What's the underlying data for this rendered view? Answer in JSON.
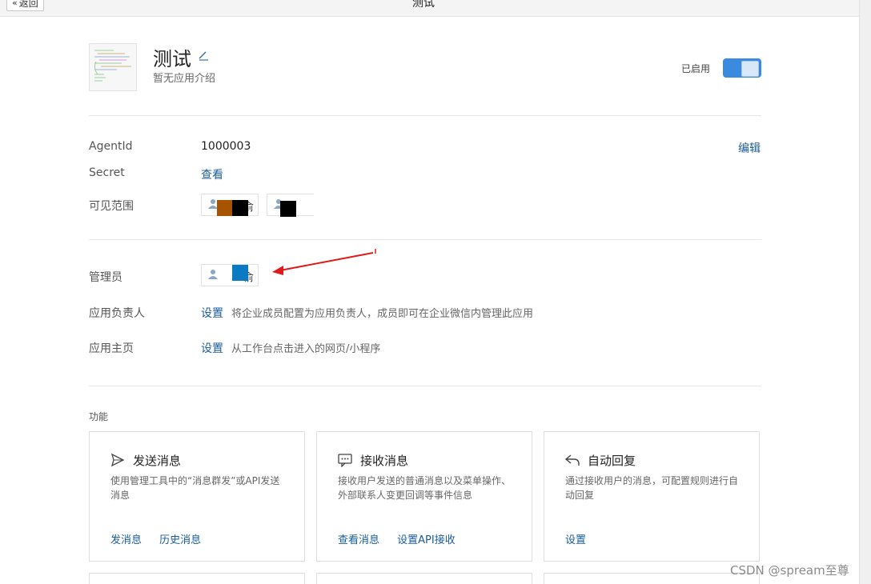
{
  "topbar": {
    "back_label": "返回",
    "title": "测试"
  },
  "app": {
    "name": "测试",
    "description": "暂无应用介绍",
    "status_label": "已启用",
    "enabled": true,
    "accent_color": "#3a8be0"
  },
  "details": {
    "agentid_label": "AgentId",
    "agentid_value": "1000003",
    "edit_label": "编辑",
    "secret_label": "Secret",
    "secret_action": "查看",
    "visibility_label": "可见范围",
    "visibility_chip_1_text": "俞",
    "visibility_chip_2_text": ""
  },
  "admin": {
    "admin_label": "管理员",
    "admin_chip_text": "俞",
    "owner_label": "应用负责人",
    "owner_action": "设置",
    "owner_hint": "将企业成员配置为应用负责人，成员即可在企业微信内管理此应用",
    "home_label": "应用主页",
    "home_action": "设置",
    "home_hint": "从工作台点击进入的网页/小程序"
  },
  "features": {
    "section_label": "功能",
    "cards": [
      {
        "icon": "send-icon",
        "title": "发送消息",
        "desc": "使用管理工具中的“消息群发”或API发送消息",
        "actions": [
          "发消息",
          "历史消息"
        ]
      },
      {
        "icon": "chat-bubble-icon",
        "title": "接收消息",
        "desc": "接收用户发送的普通消息以及菜单操作、外部联系人变更回调等事件信息",
        "actions": [
          "查看消息",
          "设置API接收"
        ]
      },
      {
        "icon": "reply-icon",
        "title": "自动回复",
        "desc": "通过接收用户的消息，可配置规则进行自动回复",
        "actions": [
          "设置"
        ]
      }
    ]
  },
  "watermark": "CSDN @spream至尊",
  "colors": {
    "link": "#1a5c9a",
    "arrow": "#e01a1a"
  }
}
